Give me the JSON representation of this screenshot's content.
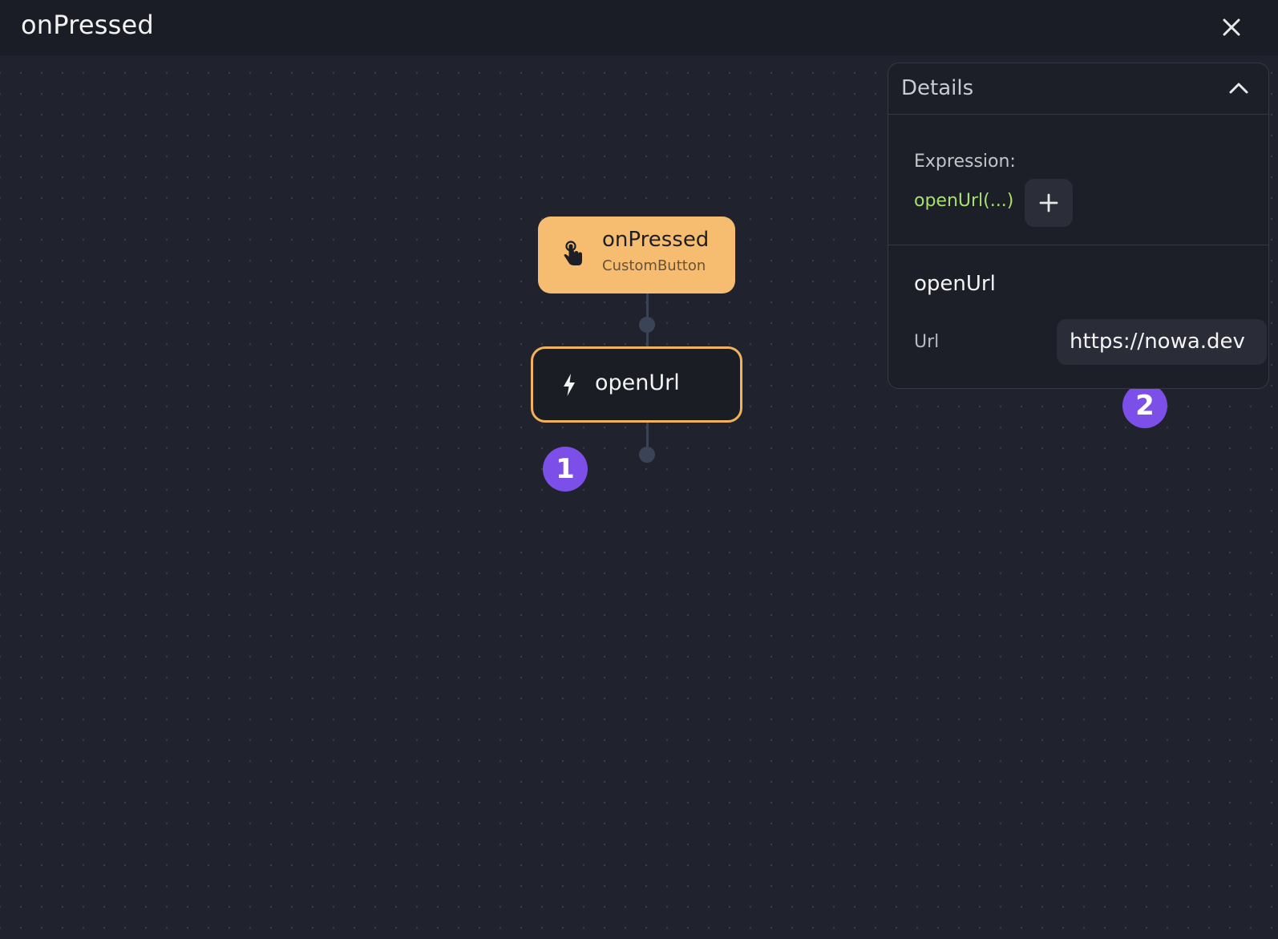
{
  "window": {
    "title": "onPressed",
    "close_icon": "close-icon"
  },
  "flow": {
    "trigger": {
      "title": "onPressed",
      "subtitle": "CustomButton",
      "icon": "tap-hand-icon",
      "color": "#f6bd70"
    },
    "action": {
      "label": "openUrl",
      "icon": "lightning-bolt-icon",
      "border_color": "#f2b25c"
    }
  },
  "badges": [
    {
      "label": "1"
    },
    {
      "label": "2"
    }
  ],
  "details": {
    "title": "Details",
    "collapse_icon": "chevron-up-icon",
    "expression_label": "Expression:",
    "expression_value": "openUrl(...)",
    "add_icon": "plus-icon",
    "function_title": "openUrl",
    "url_label": "Url",
    "url_value": "https://nowa.dev"
  },
  "colors": {
    "background": "#20232d",
    "badge": "#7b4fe8",
    "expression": "#a8e06d"
  }
}
